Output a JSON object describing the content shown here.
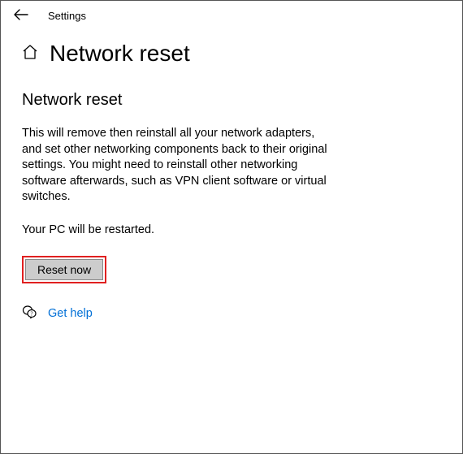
{
  "topbar": {
    "app": "Settings"
  },
  "header": {
    "title": "Network reset"
  },
  "main": {
    "heading": "Network reset",
    "description": "This will remove then reinstall all your network adapters, and set other networking components back to their original settings. You might need to reinstall other networking software afterwards, such as VPN client software or virtual switches.",
    "restart_note": "Your PC will be restarted.",
    "reset_button": "Reset now",
    "help_link": "Get help"
  }
}
